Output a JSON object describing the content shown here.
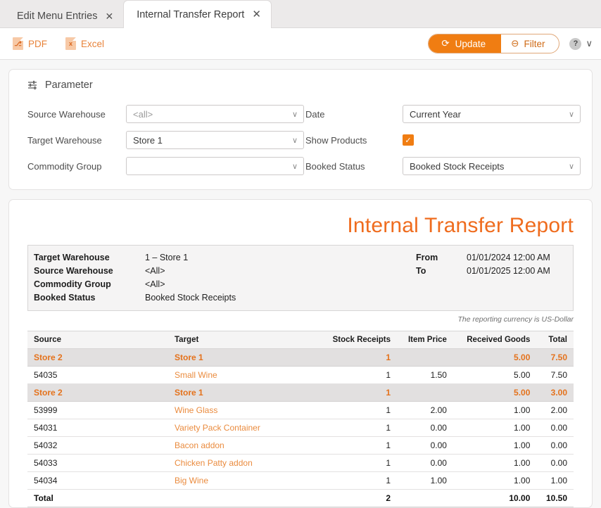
{
  "tabs": [
    {
      "label": "Edit Menu Entries",
      "close": "✕",
      "active": false
    },
    {
      "label": "Internal Transfer Report",
      "close": "✕",
      "active": true
    }
  ],
  "toolbar": {
    "pdf_label": "PDF",
    "pdf_icon_letter": "⎇",
    "excel_label": "Excel",
    "excel_icon_letter": "x",
    "update_label": "Update",
    "update_icon": "⟳",
    "filter_label": "Filter",
    "filter_icon": "⊖",
    "help_label": "?",
    "help_chevron": "∨",
    "accent_color": "#f07d12"
  },
  "parameter": {
    "title": "Parameter",
    "source_warehouse": {
      "label": "Source Warehouse",
      "value": "<all>",
      "is_placeholder": true
    },
    "target_warehouse": {
      "label": "Target Warehouse",
      "value": "Store 1",
      "is_placeholder": false
    },
    "commodity_group": {
      "label": "Commodity Group",
      "value": "",
      "is_placeholder": false
    },
    "date": {
      "label": "Date",
      "value": "Current Year"
    },
    "show_products": {
      "label": "Show Products",
      "checked": true,
      "check_glyph": "✓"
    },
    "booked_status": {
      "label": "Booked Status",
      "value": "Booked Stock Receipts"
    },
    "arrow": "∨"
  },
  "report": {
    "title": "Internal Transfer Report",
    "meta": {
      "target_warehouse_label": "Target Warehouse",
      "target_warehouse_value": "1 – Store 1",
      "source_warehouse_label": "Source Warehouse",
      "source_warehouse_value": "<All>",
      "commodity_group_label": "Commodity Group",
      "commodity_group_value": "<All>",
      "booked_status_label": "Booked Status",
      "booked_status_value": "Booked Stock Receipts",
      "from_label": "From",
      "from_value": "01/01/2024 12:00 AM",
      "to_label": "To",
      "to_value": "01/01/2025 12:00 AM"
    },
    "currency_note": "The reporting currency is US-Dollar",
    "columns": [
      "Source",
      "Target",
      "Stock Receipts",
      "Item Price",
      "Received Goods",
      "Total"
    ],
    "rows": [
      {
        "type": "group",
        "source": "Store 2",
        "target": "Store 1",
        "stock_receipts": "1",
        "item_price": "",
        "received_goods": "5.00",
        "total": "7.50"
      },
      {
        "type": "detail",
        "source": "54035",
        "target": "Small Wine",
        "stock_receipts": "1",
        "item_price": "1.50",
        "received_goods": "5.00",
        "total": "7.50"
      },
      {
        "type": "group",
        "source": "Store 2",
        "target": "Store 1",
        "stock_receipts": "1",
        "item_price": "",
        "received_goods": "5.00",
        "total": "3.00"
      },
      {
        "type": "detail",
        "source": "53999",
        "target": "Wine Glass",
        "stock_receipts": "1",
        "item_price": "2.00",
        "received_goods": "1.00",
        "total": "2.00"
      },
      {
        "type": "detail",
        "source": "54031",
        "target": "Variety Pack Container",
        "stock_receipts": "1",
        "item_price": "0.00",
        "received_goods": "1.00",
        "total": "0.00"
      },
      {
        "type": "detail",
        "source": "54032",
        "target": "Bacon addon",
        "stock_receipts": "1",
        "item_price": "0.00",
        "received_goods": "1.00",
        "total": "0.00"
      },
      {
        "type": "detail",
        "source": "54033",
        "target": "Chicken Patty addon",
        "stock_receipts": "1",
        "item_price": "0.00",
        "received_goods": "1.00",
        "total": "0.00"
      },
      {
        "type": "detail",
        "source": "54034",
        "target": "Big Wine",
        "stock_receipts": "1",
        "item_price": "1.00",
        "received_goods": "1.00",
        "total": "1.00"
      },
      {
        "type": "total",
        "source": "Total",
        "target": "",
        "stock_receipts": "2",
        "item_price": "",
        "received_goods": "10.00",
        "total": "10.50"
      }
    ]
  }
}
